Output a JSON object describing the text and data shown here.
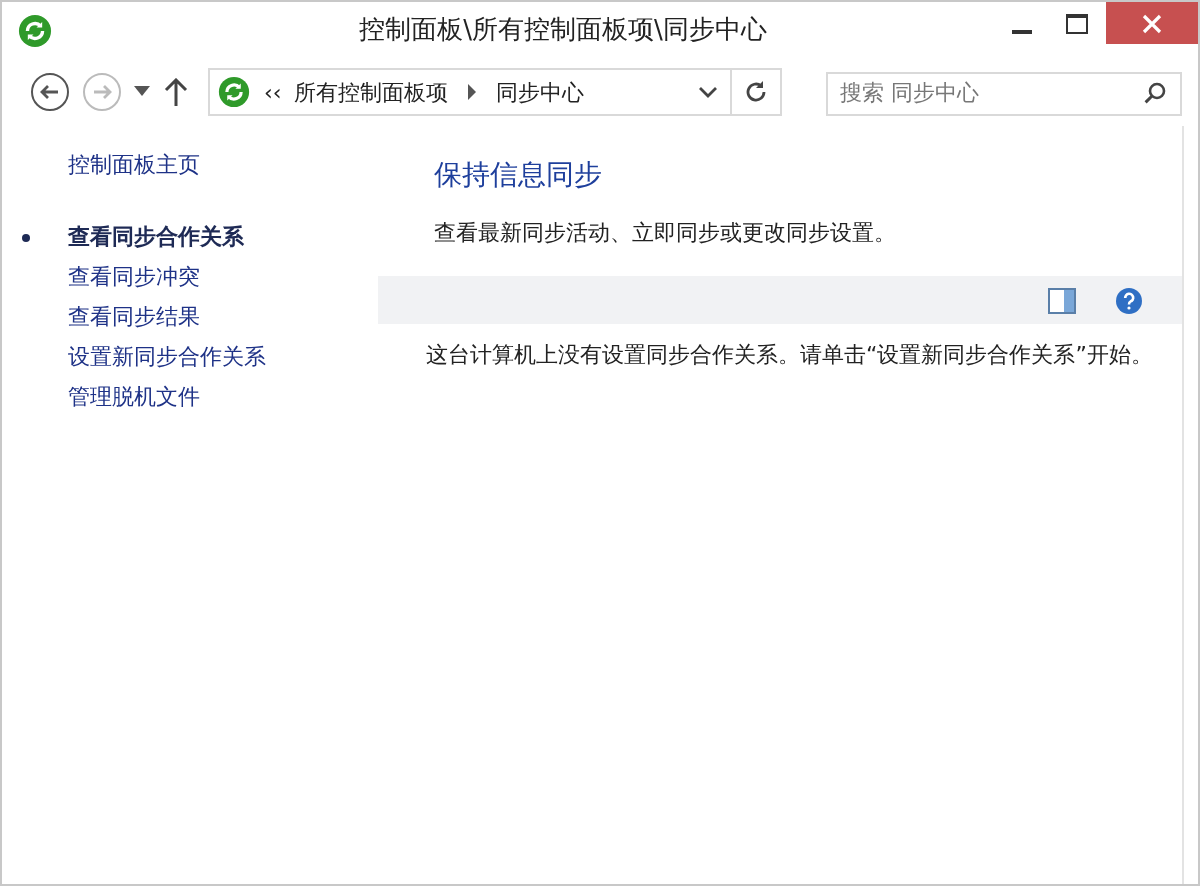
{
  "window": {
    "title": "控制面板\\所有控制面板项\\同步中心"
  },
  "address_bar": {
    "overflow": "‹‹",
    "crumbs": [
      "所有控制面板项",
      "同步中心"
    ]
  },
  "search": {
    "placeholder": "搜索 同步中心"
  },
  "sidebar": {
    "home": "控制面板主页",
    "items": [
      {
        "label": "查看同步合作关系",
        "selected": true
      },
      {
        "label": "查看同步冲突",
        "selected": false
      },
      {
        "label": "查看同步结果",
        "selected": false
      },
      {
        "label": "设置新同步合作关系",
        "selected": false
      },
      {
        "label": "管理脱机文件",
        "selected": false
      }
    ]
  },
  "content": {
    "heading": "保持信息同步",
    "description": "查看最新同步活动、立即同步或更改同步设置。",
    "message": "这台计算机上没有设置同步合作关系。请单击“设置新同步合作关系”开始。"
  }
}
